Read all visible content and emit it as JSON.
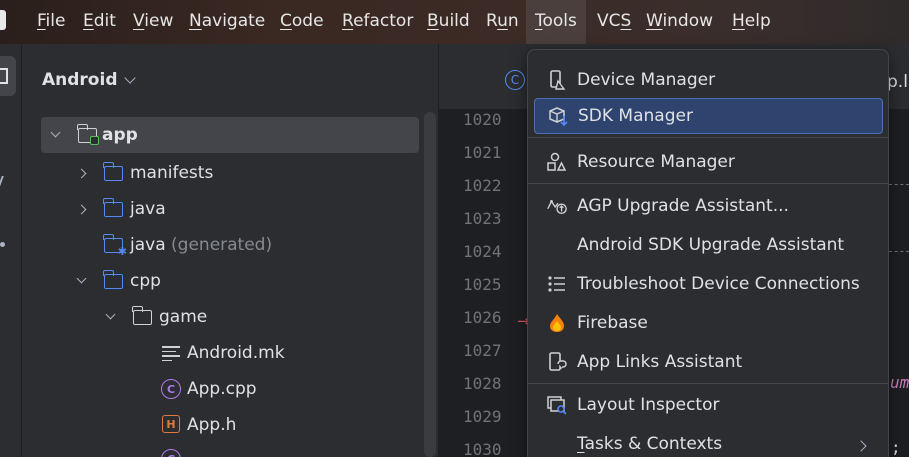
{
  "menubar": {
    "items": [
      {
        "mnemonic": "F",
        "rest": "ile"
      },
      {
        "mnemonic": "E",
        "rest": "dit"
      },
      {
        "mnemonic": "V",
        "rest": "iew"
      },
      {
        "mnemonic": "N",
        "rest": "avigate"
      },
      {
        "mnemonic": "C",
        "rest": "ode"
      },
      {
        "mnemonic": "R",
        "rest": "efactor"
      },
      {
        "mnemonic": "B",
        "rest": "uild"
      },
      {
        "pre": "R",
        "mnemonic": "u",
        "rest": "n"
      },
      {
        "mnemonic": "T",
        "rest": "ools"
      },
      {
        "pre": "VC",
        "mnemonic": "S",
        "rest": ""
      },
      {
        "mnemonic": "W",
        "rest": "indow"
      },
      {
        "mnemonic": "H",
        "rest": "elp"
      }
    ],
    "active": "Tools"
  },
  "project": {
    "view_label": "Android",
    "tree": [
      {
        "label": "app",
        "icon": "module-folder-icon"
      },
      {
        "label": "manifests",
        "icon": "folder-icon"
      },
      {
        "label": "java",
        "icon": "folder-icon"
      },
      {
        "label": "java",
        "suffix": "(generated)",
        "icon": "generated-folder-icon"
      },
      {
        "label": "cpp",
        "icon": "folder-icon"
      },
      {
        "label": "game",
        "icon": "folder-icon"
      },
      {
        "label": "Android.mk",
        "icon": "text-file-icon"
      },
      {
        "label": "App.cpp",
        "icon": "cpp-file-icon"
      },
      {
        "label": "App.h",
        "icon": "header-file-icon"
      }
    ]
  },
  "editor": {
    "tab_fragment": "p.l",
    "line_numbers": [
      "1020",
      "1021",
      "1022",
      "1023",
      "1024",
      "1025",
      "1026",
      "1027",
      "1028",
      "1029",
      "1030"
    ],
    "code_fragment": "um",
    "code_fragment_2": ";"
  },
  "tools_menu": {
    "items": [
      {
        "label": "Device Manager",
        "icon": "device-manager-icon"
      },
      {
        "label": "SDK Manager",
        "icon": "sdk-manager-icon"
      },
      {
        "label": "Resource Manager",
        "icon": "resource-manager-icon"
      },
      {
        "label": "AGP Upgrade Assistant...",
        "icon": "agp-upgrade-icon"
      },
      {
        "label": "Android SDK Upgrade Assistant",
        "icon": ""
      },
      {
        "label": "Troubleshoot Device Connections",
        "icon": "troubleshoot-list-icon"
      },
      {
        "label": "Firebase",
        "icon": "firebase-icon"
      },
      {
        "label": "App Links Assistant",
        "icon": "app-links-icon"
      },
      {
        "label": "Layout Inspector",
        "icon": "layout-inspector-icon"
      },
      {
        "label_mnemonic": "T",
        "label_rest": "asks & Contexts",
        "icon": ""
      }
    ]
  },
  "colors": {
    "accent_blue": "#548af7",
    "highlight": "#2e436e",
    "firebase_orange": "#f5820d"
  }
}
